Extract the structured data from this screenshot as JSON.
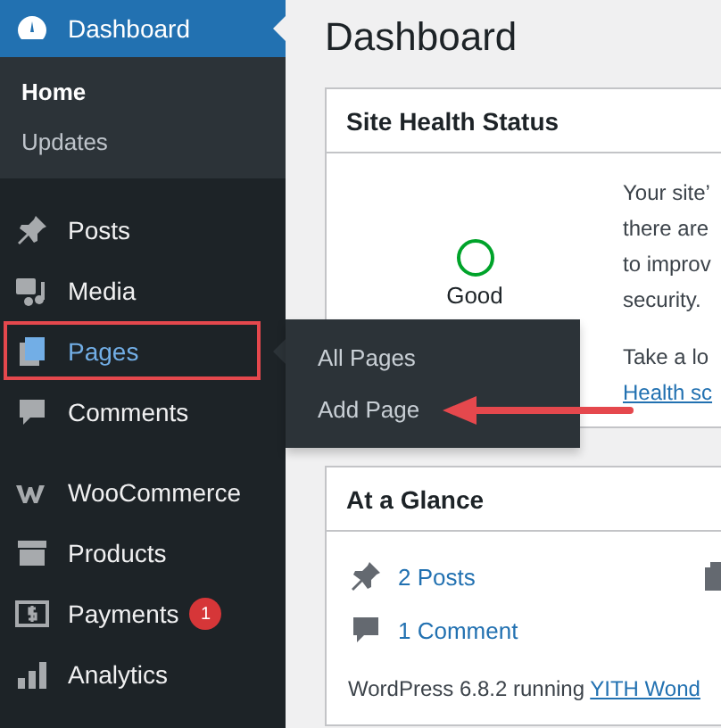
{
  "sidebar": {
    "header": {
      "label": "Dashboard",
      "selected": true
    },
    "submenu": [
      {
        "label": "Home",
        "selected": true
      },
      {
        "label": "Updates",
        "selected": false
      }
    ],
    "groups": [
      [
        {
          "label": "Posts",
          "selected": false,
          "highlighted": false
        },
        {
          "label": "Media",
          "selected": false,
          "highlighted": false
        },
        {
          "label": "Pages",
          "selected": true,
          "highlighted": true
        },
        {
          "label": "Comments",
          "selected": false,
          "highlighted": false
        }
      ],
      [
        {
          "label": "WooCommerce",
          "selected": false,
          "highlighted": false
        },
        {
          "label": "Products",
          "selected": false,
          "highlighted": false
        },
        {
          "label": "Payments",
          "selected": false,
          "highlighted": false,
          "badge": "1"
        },
        {
          "label": "Analytics",
          "selected": false,
          "highlighted": false
        }
      ]
    ]
  },
  "flyout": {
    "items": [
      {
        "label": "All Pages",
        "pointed": false
      },
      {
        "label": "Add Page",
        "pointed": true
      }
    ]
  },
  "main": {
    "title": "Dashboard",
    "health": {
      "title": "Site Health Status",
      "status": "Good",
      "lines": [
        "Your site’",
        "there are",
        "to improv",
        "security."
      ],
      "note": "Take a lo",
      "link": "Health sc"
    },
    "glance": {
      "title": "At a Glance",
      "stats": [
        "2 Posts",
        "1 Comment"
      ],
      "footer": "WordPress 6.8.2 running ",
      "footer_link": "YITH Wond"
    }
  }
}
